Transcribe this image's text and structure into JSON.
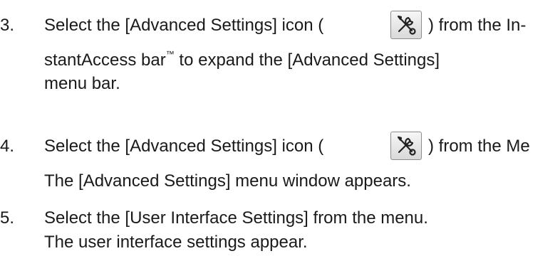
{
  "steps": [
    {
      "number": "3.",
      "line1_before_icon": "Select the [Advanced Settings] icon (",
      "line1_after_icon": ") from the In-",
      "line2_before_tm": "stantAccess bar",
      "tm": "™",
      "line2_after_tm": " to expand the [Advanced Settings]",
      "line3": "menu bar.",
      "icon": "wrench-screwdriver-icon"
    },
    {
      "number": "4.",
      "line1_before_icon": "Select the [Advanced Settings] icon (",
      "line1_after_icon": ") from the Me",
      "line2": "The [Advanced Settings] menu window appears.",
      "icon": "wrench-screwdriver-icon"
    },
    {
      "number": "5.",
      "line1": "Select the [User Interface Settings] from the menu.",
      "line2": "The user interface settings appear."
    }
  ]
}
